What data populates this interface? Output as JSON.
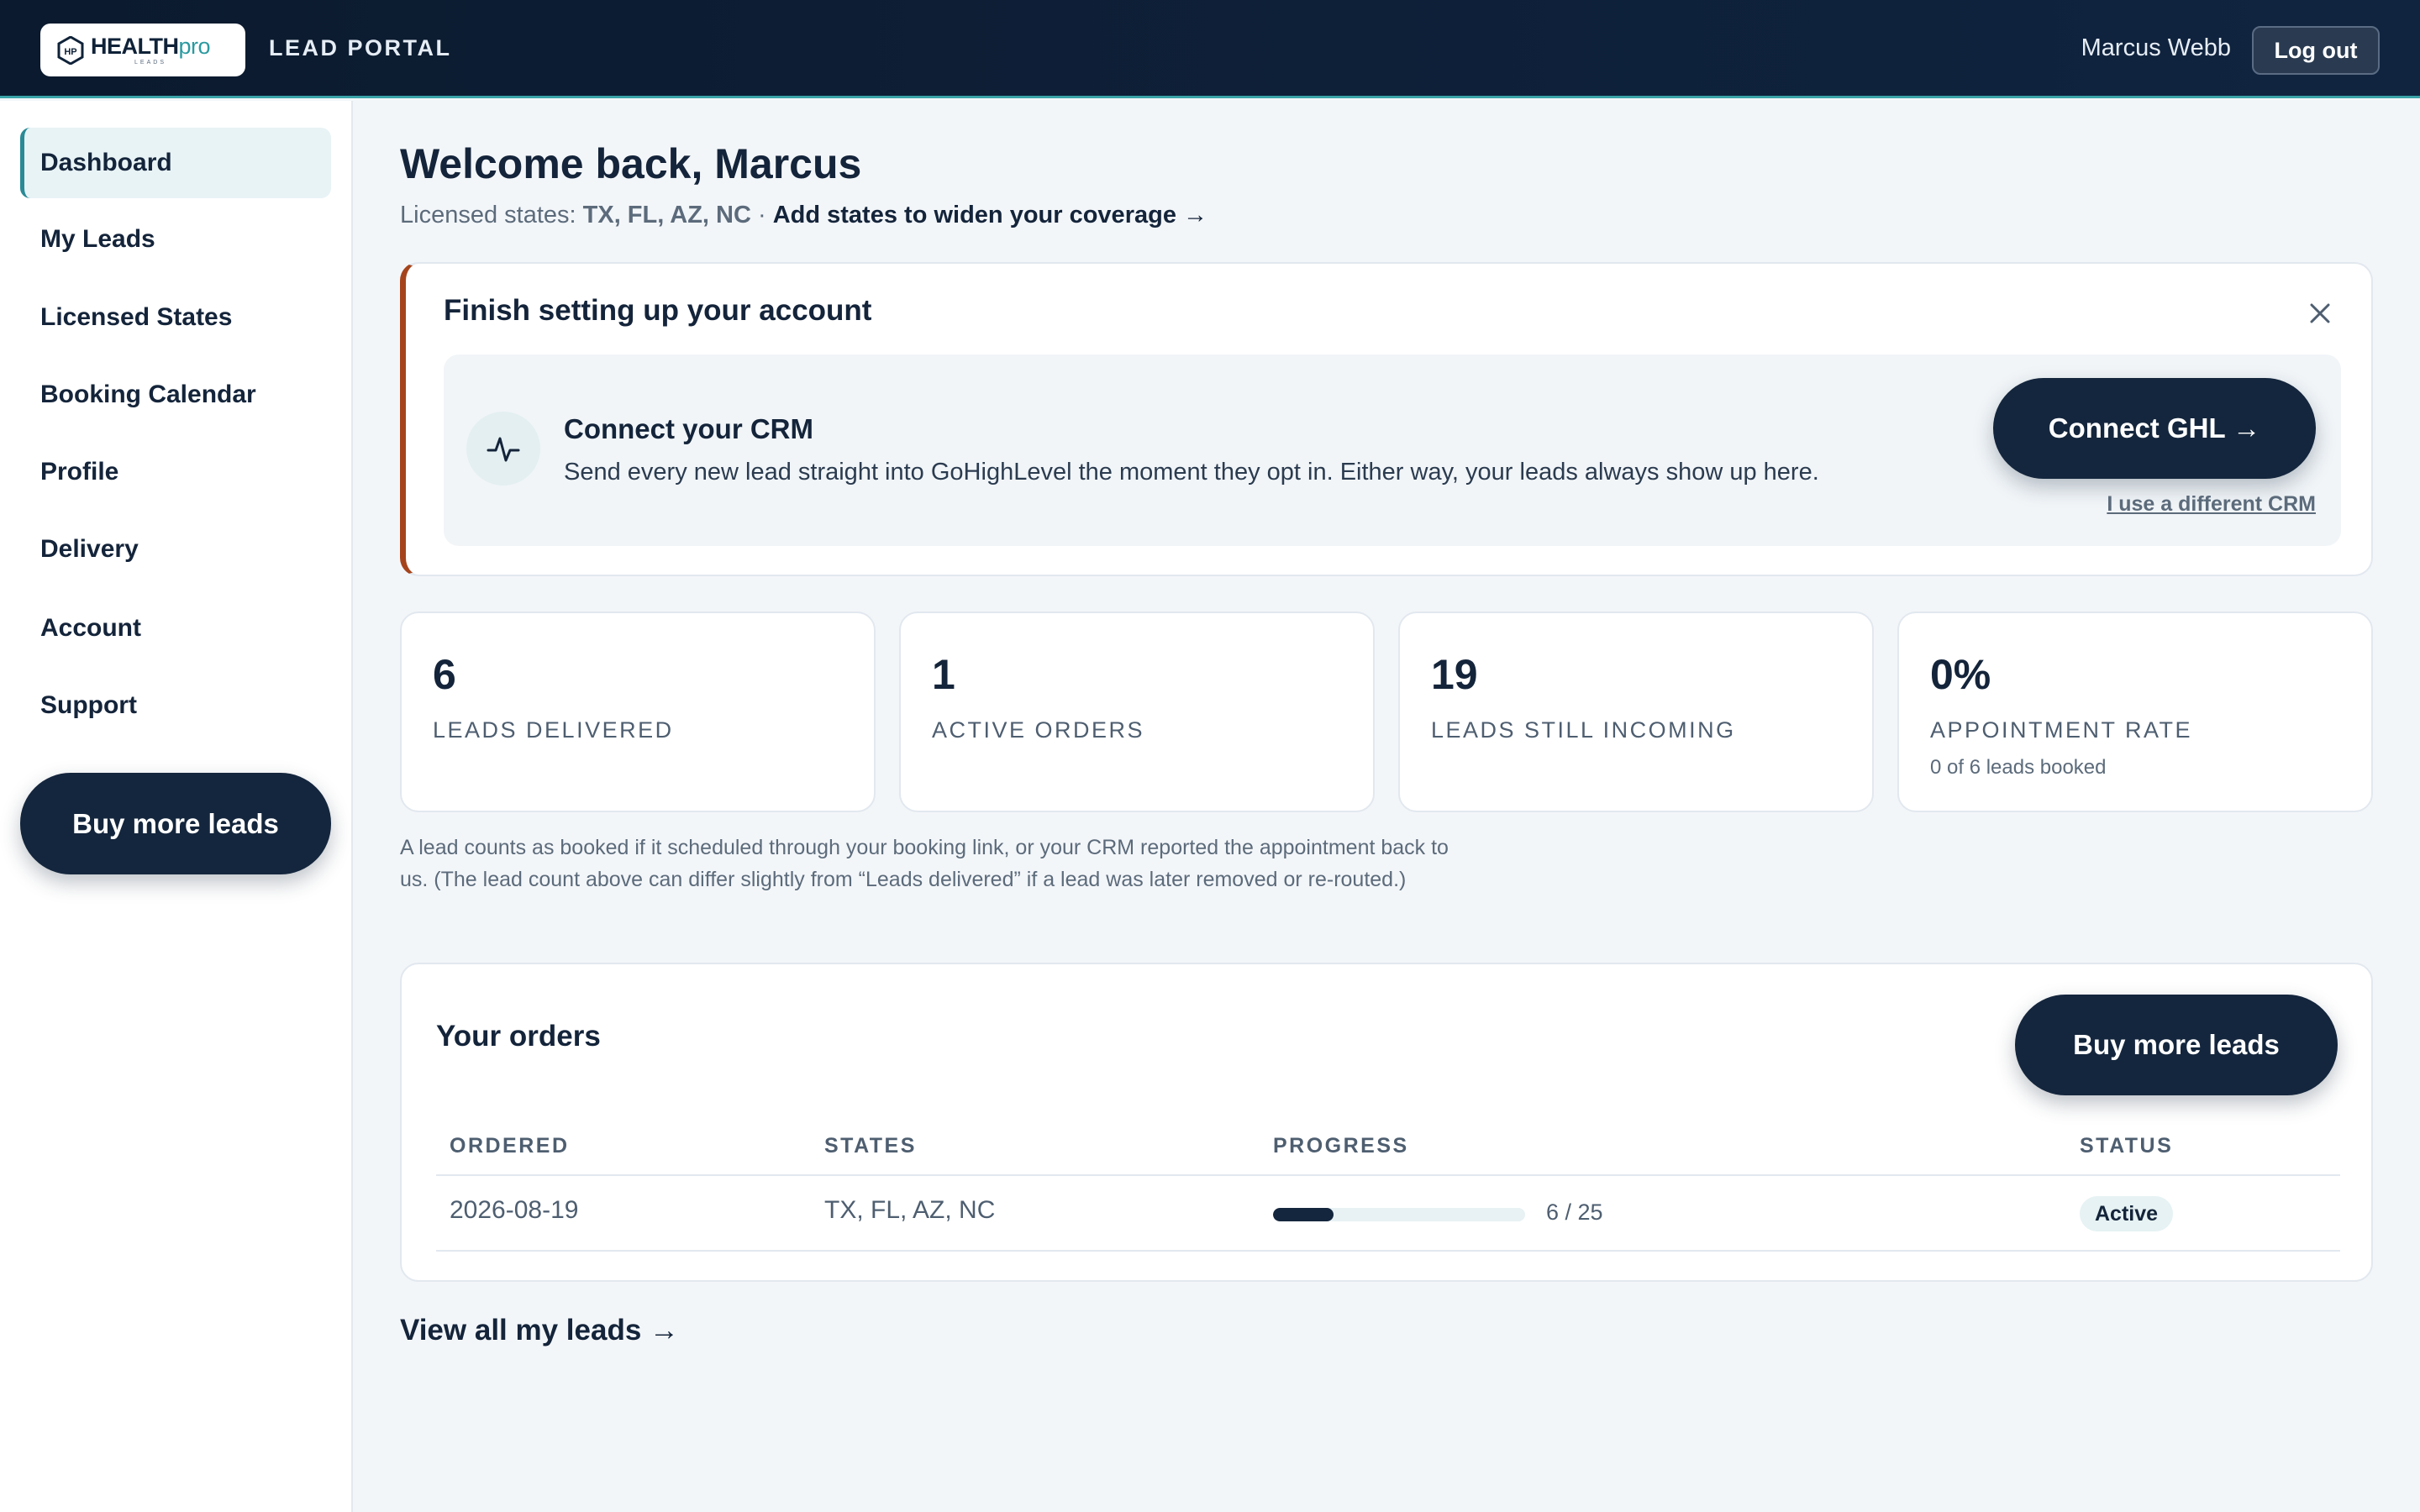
{
  "header": {
    "logo": {
      "main": "HEALTH",
      "accent": "pro",
      "sub": "LEADS",
      "mark": "HP"
    },
    "portal_title": "LEAD PORTAL",
    "user_name": "Marcus Webb",
    "logout_label": "Log out"
  },
  "sidebar": {
    "items": [
      {
        "label": "Dashboard",
        "active": true
      },
      {
        "label": "My Leads"
      },
      {
        "label": "Licensed States"
      },
      {
        "label": "Booking Calendar"
      },
      {
        "label": "Profile"
      },
      {
        "label": "Delivery"
      },
      {
        "label": "Account"
      },
      {
        "label": "Support"
      }
    ],
    "buy_label": "Buy more leads"
  },
  "main": {
    "welcome": "Welcome back, Marcus",
    "states_prefix": "Licensed states: ",
    "states_codes": "TX, FL, AZ, NC",
    "states_sep": " · ",
    "states_link": "Add states to widen your coverage →",
    "setup": {
      "title": "Finish setting up your account",
      "crm_title": "Connect your CRM",
      "crm_desc": "Send every new lead straight into GoHighLevel the moment they opt in. Either way, your leads always show up here.",
      "connect_label": "Connect GHL →",
      "diff_crm_label": "I use a different CRM"
    },
    "stats": [
      {
        "value": "6",
        "label": "LEADS DELIVERED",
        "sub": ""
      },
      {
        "value": "1",
        "label": "ACTIVE ORDERS",
        "sub": ""
      },
      {
        "value": "19",
        "label": "LEADS STILL INCOMING",
        "sub": ""
      },
      {
        "value": "0%",
        "label": "APPOINTMENT RATE",
        "sub": "0 of 6 leads booked"
      }
    ],
    "note": "A lead counts as booked if it scheduled through your booking link, or your CRM reported the appointment back to us. (The lead count above can differ slightly from “Leads delivered” if a lead was later removed or re-routed.)",
    "orders": {
      "title": "Your orders",
      "buy_label": "Buy more leads",
      "columns": [
        "ORDERED",
        "STATES",
        "PROGRESS",
        "STATUS"
      ],
      "rows": [
        {
          "ordered": "2026-08-19",
          "states": "TX, FL, AZ, NC",
          "progress_text": "6 / 25",
          "progress_fraction": 0.24,
          "status": "Active"
        }
      ]
    },
    "view_all_label": "View all my leads →"
  }
}
